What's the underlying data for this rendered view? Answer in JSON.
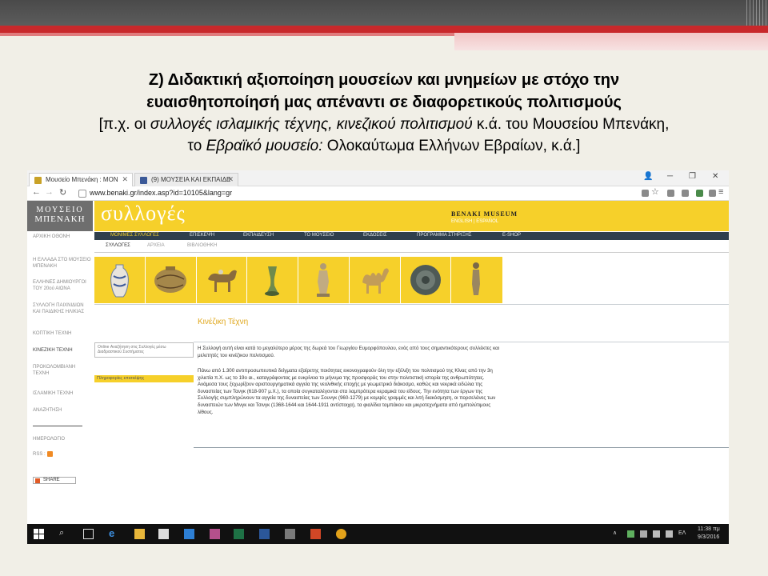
{
  "slide": {
    "heading_line1": "Ζ) Διδακτική αξιοποίηση  μουσείων και μνημείων με στόχο την",
    "heading_line2": "ευαισθητοποίησή μας απέναντι σε διαφορετικούς πολιτισμούς",
    "line3_a": "[π.χ. οι ",
    "line3_b": "συλλογές ισλαμικής τέχνης, κινεζικού πολιτισμού",
    "line3_c": " κ.ά. του Μουσείου Μπενάκη,",
    "line4_a": "το ",
    "line4_b": "Εβραϊκό μουσείο:",
    "line4_c": " Ολοκαύτωμα Ελλήνων Εβραίων, κ.ά.]",
    "colors": {
      "red": "#c8282b",
      "dark": "#4a4a4a"
    }
  },
  "browser": {
    "tabs": [
      {
        "label": "Μουσείο Μπενάκη : ΜΟΝ",
        "icon": "benaki-favicon"
      },
      {
        "label": "(9) ΜΟΥΣΕΙΑ ΚΑΙ ΕΚΠΑΙΔΕ",
        "icon": "facebook-icon"
      }
    ],
    "url": "www.benaki.gr/index.asp?id=10105&lang=gr"
  },
  "site": {
    "logo_line1": "ΜΟΥΣΕΙΟ",
    "logo_line2": "ΜΠΕΝΑΚΗ",
    "banner_title": "συλλογές",
    "banner_brand": "BENAKI MUSEUM",
    "banner_langs": "ENGLISH | ESPAÑOL",
    "accent": "#f6d02a",
    "menu": [
      "ΜΟΝΙΜΕΣ ΣΥΛΛΟΓΕΣ",
      "ΕΠΙΣΚΕΨΗ",
      "ΕΚΠΑΙΔΕΥΣΗ",
      "ΤΟ ΜΟΥΣΕΙΟ",
      "ΕΚΔΟΣΕΙΣ",
      "ΠΡΟΓΡΑΜΜΑ ΣΤΗΡΙΞΗΣ",
      "E-SHOP"
    ],
    "submenu": [
      "ΣΥΛΛΟΓΕΣ",
      "ΑΡΧΕΙΑ",
      "ΒΙΒΛΙΟΘΗΚΗ"
    ],
    "sidebar": [
      "ΑΡΧΙΚΗ ΟΘΟΝΗ",
      "Η ΕΛΛΑΔΑ ΣΤΟ ΜΟΥΣΕΙΟ ΜΠΕΝΑΚΗ",
      "ΕΛΛΗΝΕΣ ΔΗΜΙΟΥΡΓΟΙ ΤΟΥ 20ού ΑΙΩΝΑ",
      "ΣΥΛΛΟΓΗ ΠΑΙΧΝΙΔΙΩΝ ΚΑΙ ΠΑΙΔΙΚΗΣ ΗΛΙΚΙΑΣ",
      "ΚΟΠΤΙΚΗ ΤΕΧΝΗ",
      "ΚΙΝΕΖΙΚΗ ΤΕΧΝΗ",
      "ΠΡΟΚΟΛΟΜΒΙΑΝΗ ΤΕΧΝΗ",
      "ΙΣΛΑΜΙΚΗ ΤΕΧΝΗ",
      "ΑΝΑΖΗΤΗΣΗ"
    ],
    "sidebar_calendar": "ΗΜΕΡΟΛΟΓΙΟ",
    "sidebar_rss": "RSS :",
    "share_label": "SHARE",
    "section_title": "Κινέζικη Τέχνη",
    "search_box": "Online Αναζήτηση στις Συλλογές μέσω Διαδραστικού Συστήματος",
    "info_box": "Πληροφορίες επισκέψης",
    "paragraph1": "Η Συλλογή αυτή είναι κατά το μεγαλύτερο μέρος της δωρεά του Γεωργίου Ευμορφόπουλου, ενός από τους σημαντικότερους συλλέκτες και μελετητές του κινέζικου πολιτισμού.",
    "paragraph2": "Πάνω από 1.300 αντιπροσωπευτικά δείγματα εξαίρετης ποιότητας εικονογραφούν όλη την εξέλιξη του πολιτισμού της Κίνας από την 3η χιλιετία π.Χ. ως το 19ο αι., καταγράφοντας με ευκρίνεια το μήνυμα της προσφοράς του στην πολιτιστική ιστορία της ανθρωπότητας. Ανάμεσα τους ξεχωρίζουν αριστουργηματικά αγγεία της νεολιθικής εποχής με γεωμετρικό διάκοσμο, καθώς και νεκρικά ειδώλια της δυναστείας των Τανγκ (618-907 μ.Χ.), τα οποία συγκαταλέγονται στα λαμπρότερα κεραμικά του είδους. Την ενότητα των έργων της Συλλογής συμπληρώνουν τα αγγεία της δυναστείας των Σουνγκ (960-1279) με κομψές γραμμές και λιτή διακόσμηση, οι πορσελάνες των δυναστειών των Μινγκ και Τσινγκ (1368-1644 και 1644-1911 αντίστοιχα), τα φιαλίδια ταμπάκου και μικροτεχνήματα από ημιπολύτιμους λίθους."
  },
  "thumbnails": [
    "vase-icon",
    "jar-icon",
    "horse-figurine-icon",
    "stem-cup-icon",
    "tomb-figure-icon",
    "camel-figurine-icon",
    "plate-icon",
    "standing-figure-icon"
  ],
  "taskbar": {
    "lang": "ΕΛ",
    "time": "11:38 πμ",
    "date": "9/3/2016"
  }
}
